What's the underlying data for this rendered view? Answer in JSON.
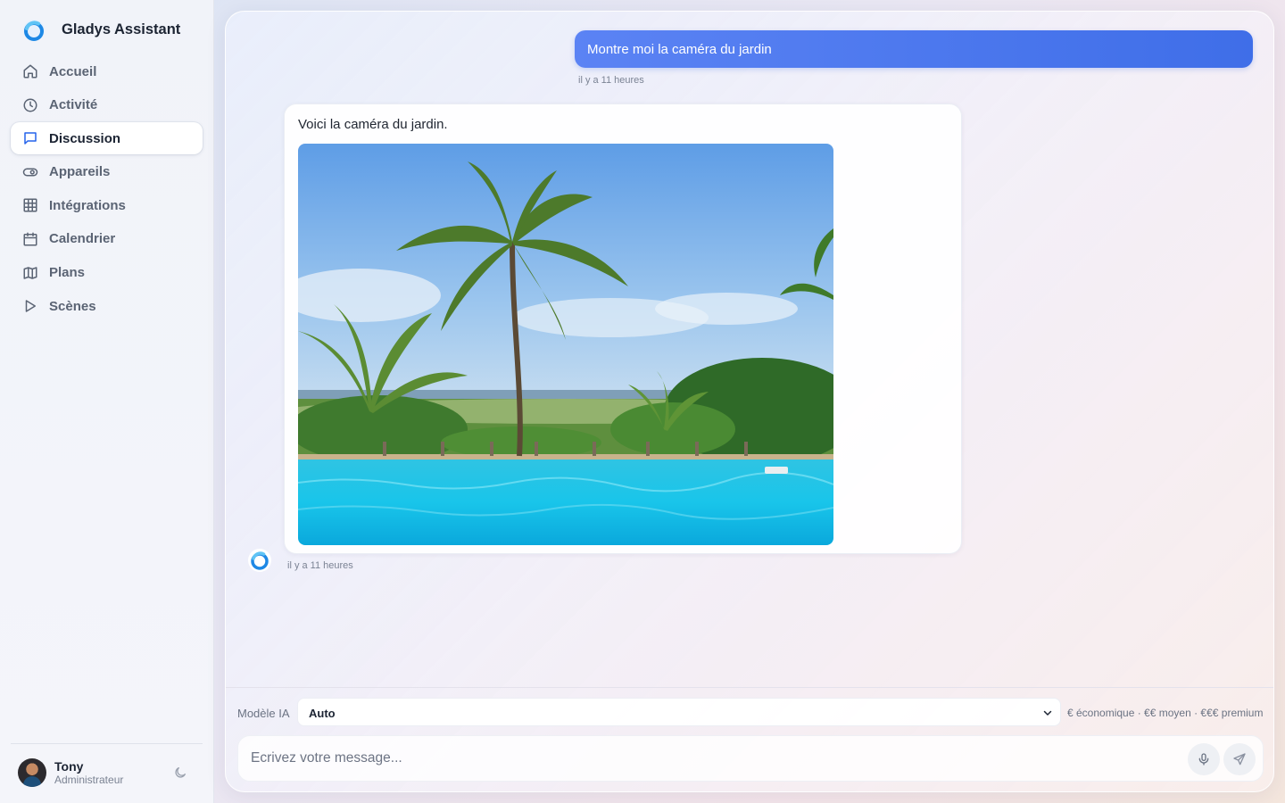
{
  "app": {
    "title": "Gladys Assistant",
    "logo_icon": "gladys-logo-icon"
  },
  "sidebar": {
    "items": [
      {
        "label": "Accueil",
        "icon": "home-icon",
        "active": false
      },
      {
        "label": "Activité",
        "icon": "clock-icon",
        "active": false
      },
      {
        "label": "Discussion",
        "icon": "message-square-icon",
        "active": true
      },
      {
        "label": "Appareils",
        "icon": "toggle-icon",
        "active": false
      },
      {
        "label": "Intégrations",
        "icon": "grid-icon",
        "active": false
      },
      {
        "label": "Calendrier",
        "icon": "calendar-icon",
        "active": false
      },
      {
        "label": "Plans",
        "icon": "map-icon",
        "active": false
      },
      {
        "label": "Scènes",
        "icon": "play-icon",
        "active": false
      }
    ],
    "user": {
      "name": "Tony",
      "role": "Administrateur",
      "theme_icon": "moon-icon"
    }
  },
  "chat": {
    "messages": [
      {
        "from": "user",
        "text": "Montre moi la caméra du jardin",
        "time": "il y a 11 heures"
      },
      {
        "from": "assistant",
        "text": "Voici la caméra du jardin.",
        "image": "garden-camera-snapshot",
        "time": "il y a 11 heures"
      }
    ]
  },
  "composer": {
    "model_label": "Modèle IA",
    "model_value": "Auto",
    "model_hint": "€ économique · €€ moyen · €€€ premium",
    "placeholder": "Ecrivez votre message...",
    "mic_icon": "microphone-icon",
    "send_icon": "send-icon"
  },
  "colors": {
    "accent": "#2563eb",
    "user_bubble": "#4a78ee",
    "sidebar_bg": "#f2f4f9",
    "text_muted": "#5b6474"
  }
}
